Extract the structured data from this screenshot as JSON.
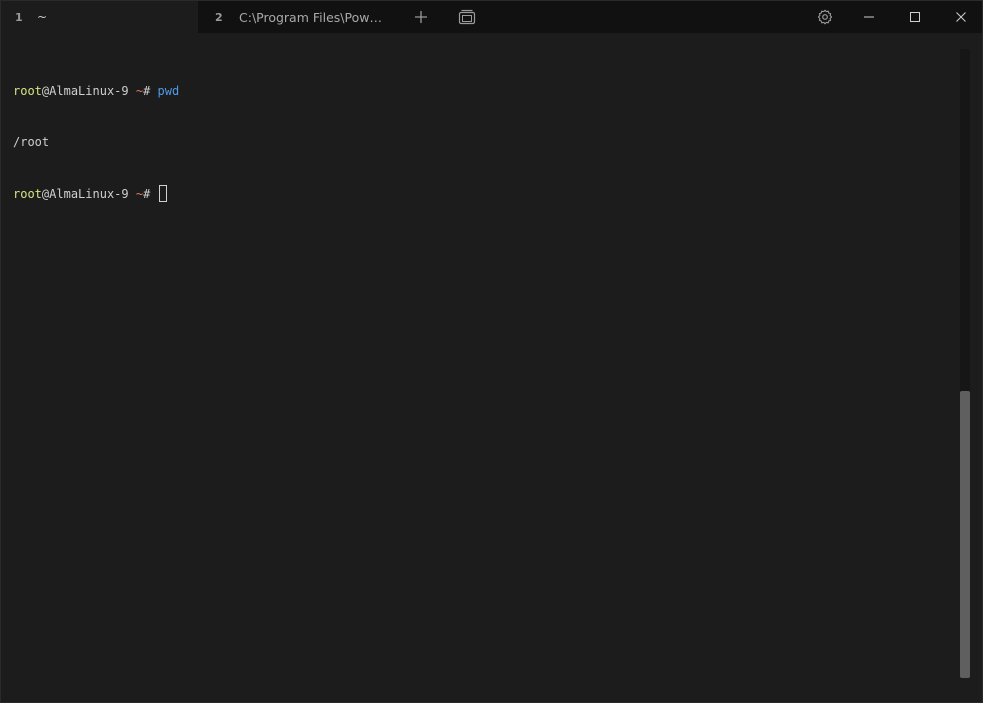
{
  "tabs": [
    {
      "index": "1",
      "title": "~",
      "active": true
    },
    {
      "index": "2",
      "title": "C:\\Program Files\\Pow…",
      "active": false
    }
  ],
  "titlebar": {
    "new_tab_icon": "plus-icon",
    "tab_overview_icon": "tab-overview-icon",
    "settings_icon": "gear-icon",
    "minimize_icon": "minimize-icon",
    "maximize_icon": "maximize-icon",
    "close_icon": "close-icon"
  },
  "terminal": {
    "lines": [
      {
        "user": "root",
        "at": "@",
        "host": "AlmaLinux-9",
        "path": " ~",
        "hash": "#",
        "command": " pwd"
      },
      {
        "output": "/root"
      },
      {
        "user": "root",
        "at": "@",
        "host": "AlmaLinux-9",
        "path": " ~",
        "hash": "#",
        "command": " "
      }
    ],
    "colors": {
      "user": "#d7e383",
      "path": "#e3795d",
      "command": "#4f9ae8",
      "background": "#1c1c1c"
    }
  }
}
